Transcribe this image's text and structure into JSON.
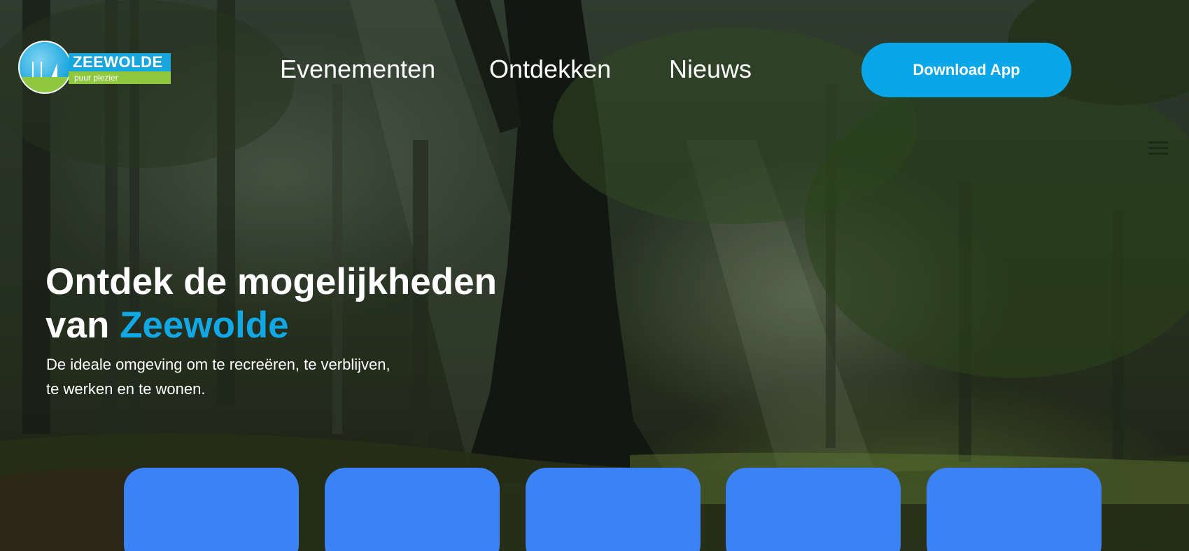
{
  "logo": {
    "name": "ZEEWOLDE",
    "tagline": "puur plezier"
  },
  "nav": {
    "items": [
      {
        "label": "Evenementen"
      },
      {
        "label": "Ontdekken"
      },
      {
        "label": "Nieuws"
      }
    ]
  },
  "cta": {
    "label": "Download App"
  },
  "hero": {
    "title_line1": "Ontdek de mogelijkheden",
    "title_line2_prefix": "van ",
    "title_accent": "Zeewolde",
    "subtitle_line1": "De ideale omgeving om te recreëren, te verblijven,",
    "subtitle_line2": "te werken en te wonen."
  },
  "colors": {
    "accent": "#12a8e6",
    "button": "#0aa7e8",
    "card": "#3b82f6",
    "logo_blue": "#19a6dd",
    "logo_green": "#8fc73e"
  },
  "icons": {
    "menu": "hamburger-menu-icon"
  }
}
